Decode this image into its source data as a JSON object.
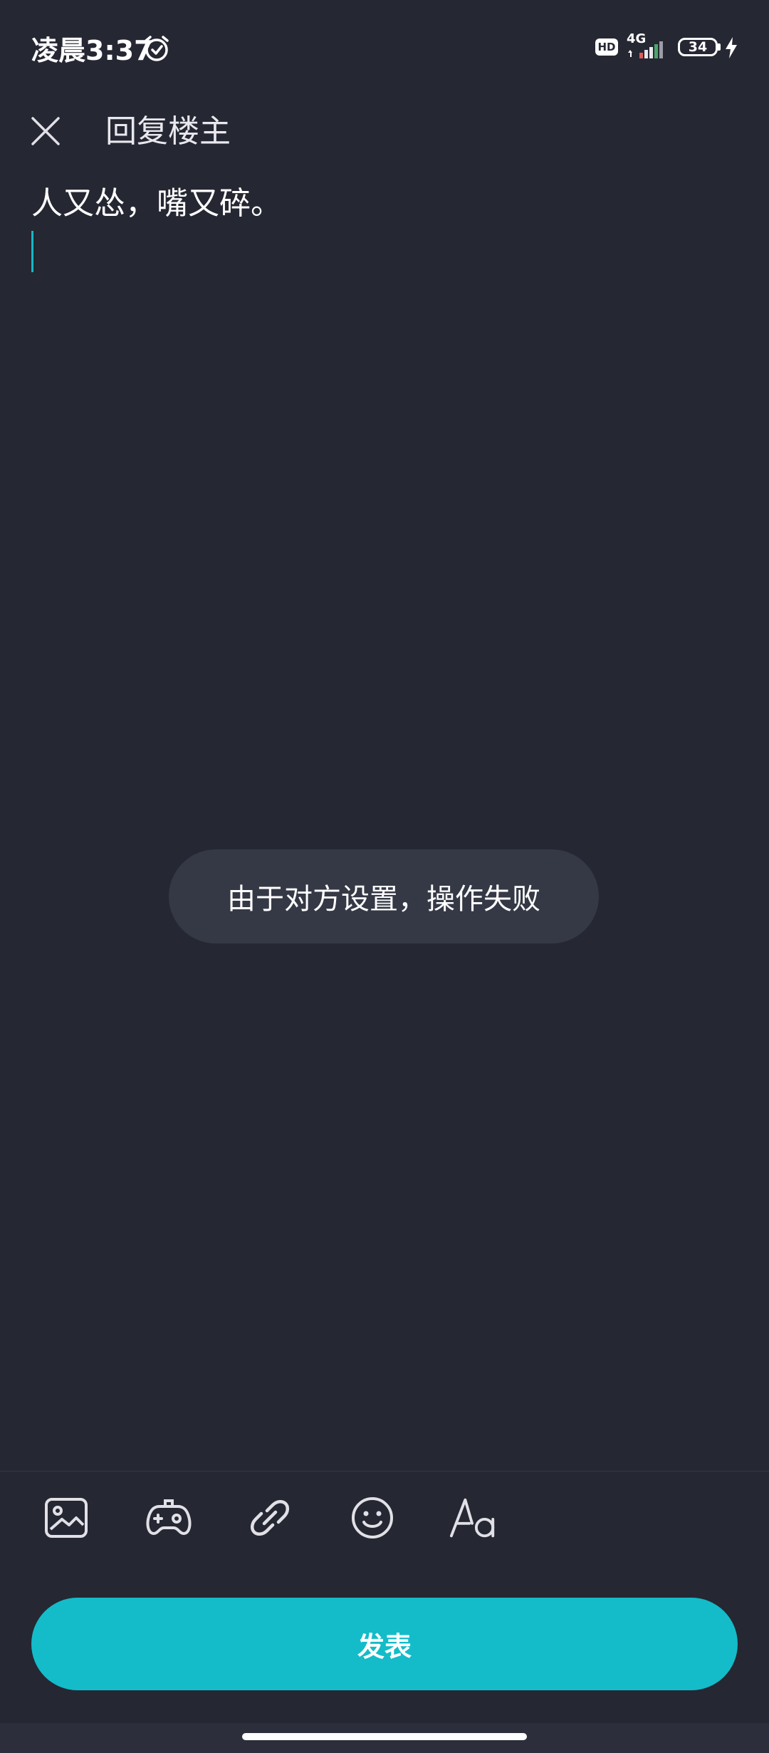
{
  "status_bar": {
    "time": "凌晨3:37",
    "hd_label": "HD",
    "network_type": "4G",
    "battery_level": "34",
    "icons": [
      "alarm-icon",
      "signal-icon",
      "charging-icon"
    ]
  },
  "header": {
    "title": "回复楼主",
    "close_icon": "close-icon"
  },
  "editor": {
    "content": "人又怂，嘴又碎。"
  },
  "toast": {
    "message": "由于对方设置，操作失败"
  },
  "toolbar": {
    "items": [
      {
        "name": "image-icon"
      },
      {
        "name": "gamepad-icon"
      },
      {
        "name": "link-icon"
      },
      {
        "name": "emoji-icon"
      },
      {
        "name": "text-format-icon"
      }
    ]
  },
  "publish": {
    "label": "发表"
  },
  "colors": {
    "background": "#252733",
    "accent": "#13bcc8",
    "toast_bg": "#353946"
  }
}
